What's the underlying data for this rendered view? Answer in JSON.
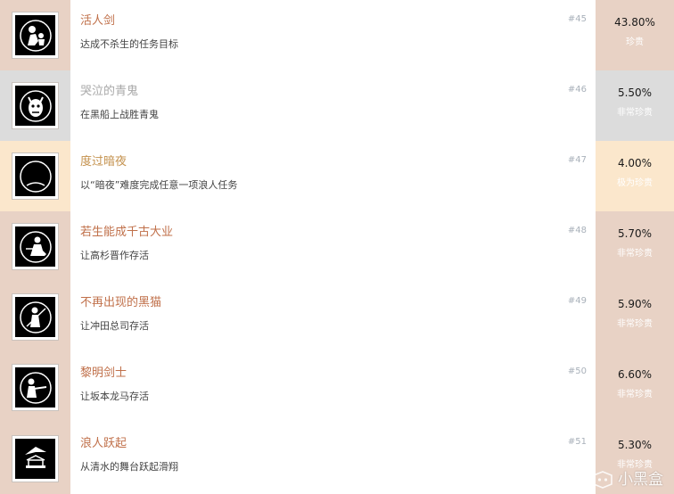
{
  "colors": {
    "title_default": "#c0704a",
    "title_muted": "#a8a8a8",
    "title_gold": "#c4924e",
    "rank": "#a9b1ba",
    "side_warm": "#e8d2c5",
    "side_gray": "#dcdcdc",
    "side_cream": "#fbe7cc"
  },
  "achievements": [
    {
      "icon": "samurai-child-badge-icon",
      "title": "活人剑",
      "description": "达成不杀生的任务目标",
      "rank": "#45",
      "percent": "43.80%",
      "rarity": "珍贵",
      "side_color": "#e8d2c5",
      "title_color": "#c0704a"
    },
    {
      "icon": "crying-oni-badge-icon",
      "title": "哭泣的青鬼",
      "description": "在黑船上战胜青鬼",
      "rank": "#46",
      "percent": "5.50%",
      "rarity": "非常珍贵",
      "side_color": "#dcdcdc",
      "title_color": "#a8a8a8"
    },
    {
      "icon": "dark-night-badge-icon",
      "title": "度过暗夜",
      "description": "以“暗夜”难度完成任意一项浪人任务",
      "rank": "#47",
      "percent": "4.00%",
      "rarity": "极为珍贵",
      "side_color": "#fbe7cc",
      "title_color": "#c4924e"
    },
    {
      "icon": "seated-warrior-badge-icon",
      "title": "若生能成千古大业",
      "description": "让高杉晋作存活",
      "rank": "#48",
      "percent": "5.70%",
      "rarity": "非常珍贵",
      "side_color": "#e8d2c5",
      "title_color": "#c0704a"
    },
    {
      "icon": "swordsman-badge-icon",
      "title": "不再出现的黑猫",
      "description": "让冲田总司存活",
      "rank": "#49",
      "percent": "5.90%",
      "rarity": "非常珍贵",
      "side_color": "#e8d2c5",
      "title_color": "#c0704a"
    },
    {
      "icon": "gunman-badge-icon",
      "title": "黎明剑士",
      "description": "让坂本龙马存活",
      "rank": "#50",
      "percent": "6.60%",
      "rarity": "非常珍贵",
      "side_color": "#e8d2c5",
      "title_color": "#c0704a"
    },
    {
      "icon": "glider-stage-badge-icon",
      "title": "浪人跃起",
      "description": "从清水的舞台跃起滑翔",
      "rank": "#51",
      "percent": "5.30%",
      "rarity": "非常珍贵",
      "side_color": "#e8d2c5",
      "title_color": "#c0704a"
    }
  ],
  "watermark": {
    "icon": "xiaoheihe-logo-icon",
    "text": "小黑盒"
  }
}
